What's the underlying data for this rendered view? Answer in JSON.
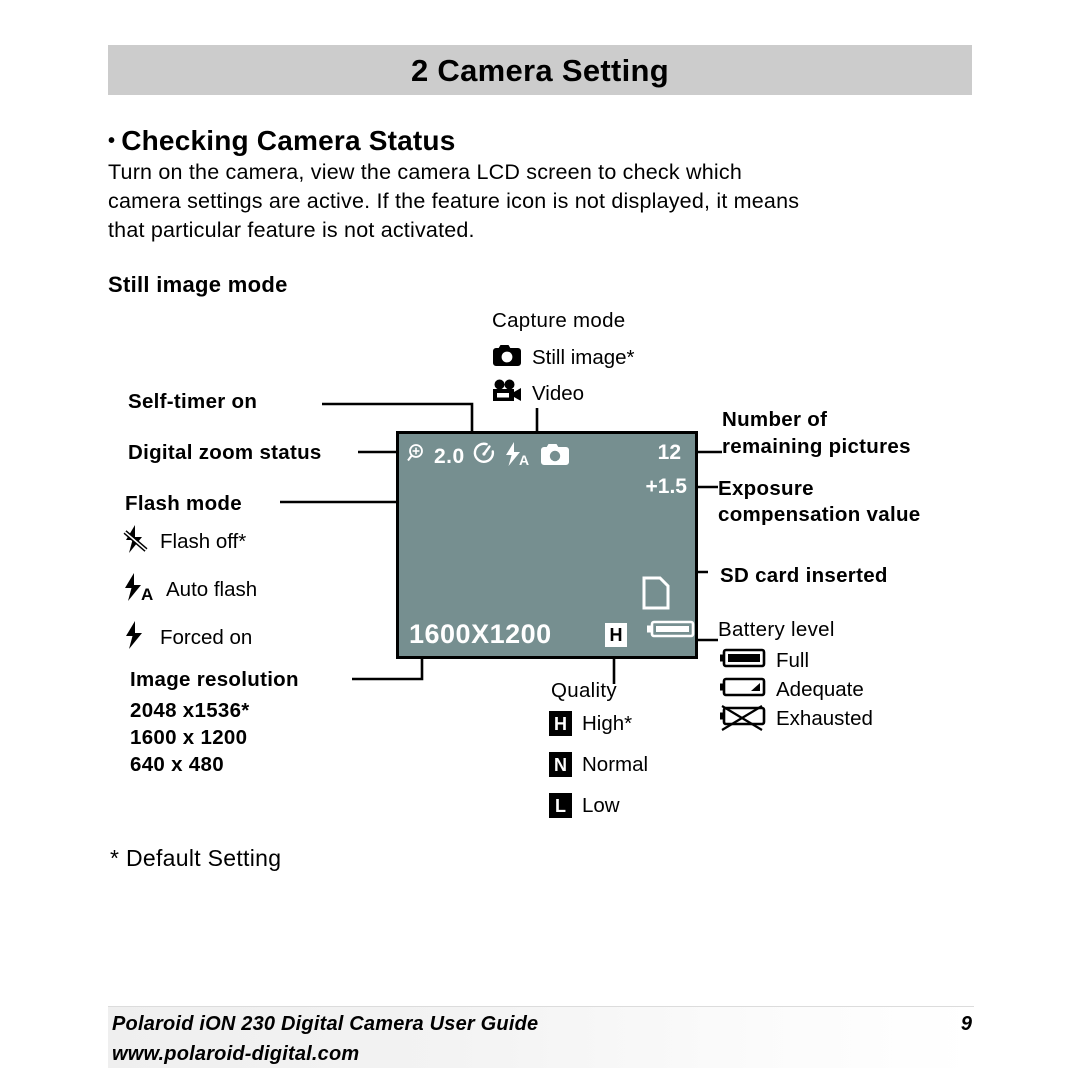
{
  "colors": {
    "chapter_bar": "#cccccc",
    "lcd_background": "#768f90",
    "ink": "#000000",
    "lcd_text": "#ffffff"
  },
  "header": {
    "chapter_title": "2 Camera Setting"
  },
  "section": {
    "bullet": "•",
    "heading": "Checking Camera Status",
    "paragraph_line1": "Turn on the camera, view the camera LCD screen to check which",
    "paragraph_line2": "camera settings are active. If the feature icon is not displayed, it means",
    "paragraph_line3": "that particular feature is not activated.",
    "subheading": "Still image mode"
  },
  "diagram": {
    "capture_mode": {
      "title": "Capture mode",
      "options": [
        {
          "icon": "still-camera-icon",
          "label": "Still image*"
        },
        {
          "icon": "video-camera-icon",
          "label": "Video"
        }
      ]
    },
    "left_callouts": {
      "self_timer": "Self-timer on",
      "digital_zoom": "Digital zoom status",
      "flash_mode_title": "Flash mode",
      "flash_options": [
        {
          "icon": "flash-off-icon",
          "label": "Flash off*"
        },
        {
          "icon": "auto-flash-icon",
          "label": "Auto flash"
        },
        {
          "icon": "forced-flash-icon",
          "label": "Forced on"
        }
      ],
      "image_resolution_title": "Image resolution",
      "resolutions": [
        "2048 x1536*",
        "1600 x 1200",
        "640 x 480"
      ]
    },
    "right_callouts": {
      "remaining_line1": "Number of",
      "remaining_line2": "remaining pictures",
      "exposure_line1": "Exposure",
      "exposure_line2": "compensation value",
      "sd_card": "SD card inserted",
      "battery_title": "Battery level",
      "battery_options": [
        {
          "icon": "battery-full-icon",
          "label": "Full"
        },
        {
          "icon": "battery-adequate-icon",
          "label": "Adequate"
        },
        {
          "icon": "battery-exhausted-icon",
          "label": "Exhausted"
        }
      ]
    },
    "quality": {
      "title": "Quality",
      "options": [
        {
          "badge": "H",
          "label": "High*"
        },
        {
          "badge": "N",
          "label": "Normal"
        },
        {
          "badge": "L",
          "label": "Low"
        }
      ]
    },
    "lcd_screen": {
      "zoom_value": "2.0",
      "remaining_count": "12",
      "exposure_value": "+1.5",
      "resolution": "1600X1200",
      "quality_badge": "H",
      "icons": [
        "magnifier-plus-icon",
        "self-timer-icon",
        "auto-flash-icon",
        "still-camera-icon",
        "sd-card-icon",
        "battery-full-icon"
      ]
    }
  },
  "footnote": {
    "text": "* Default Setting"
  },
  "footer": {
    "product_line": "Polaroid iON 230 Digital Camera User Guide",
    "website": "www.polaroid-digital.com",
    "page_number": "9"
  }
}
